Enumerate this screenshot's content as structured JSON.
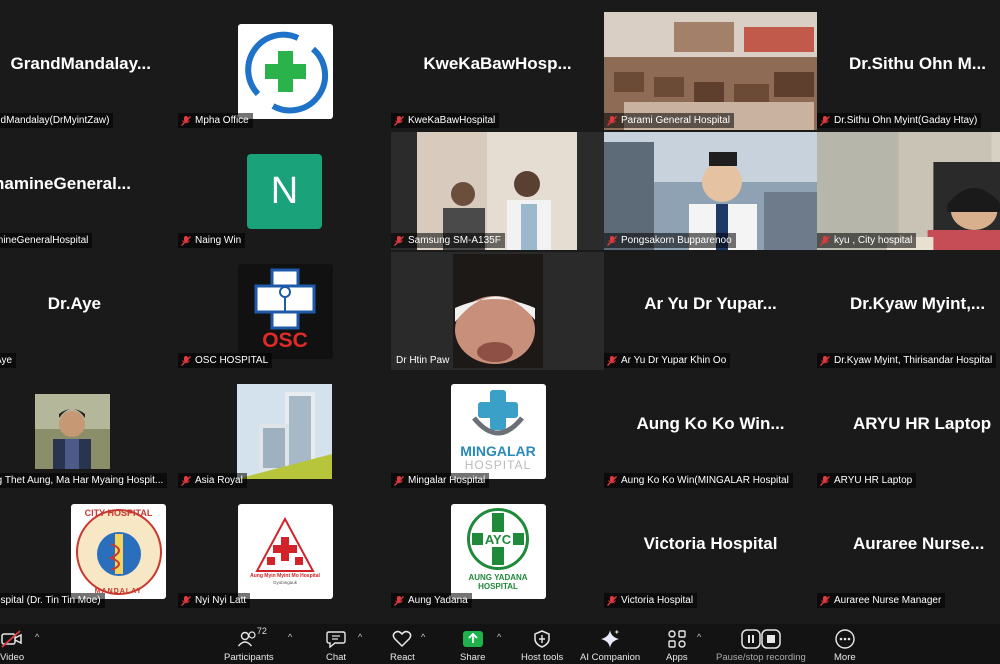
{
  "tiles": [
    {
      "name": "GrandMandalay...",
      "label": "ndMandalay(DrMyintZaw)"
    },
    {
      "name": "",
      "label": "Mpha Office"
    },
    {
      "name": "KweKaBawHosp...",
      "label": "KweKaBawHospital"
    },
    {
      "name": "",
      "label": "Parami General Hospital"
    },
    {
      "name": "Dr.Sithu Ohn M...",
      "label": "Dr.Sithu Ohn Myint(Gaday Htay)"
    },
    {
      "name": "ThamineGeneral...",
      "label": "mineGeneralHospital"
    },
    {
      "name": "",
      "label": "Naing Win",
      "avatar": "N"
    },
    {
      "name": "",
      "label": "Samsung SM-A135F"
    },
    {
      "name": "",
      "label": "Pongsakorn Bupparenoo"
    },
    {
      "name": "",
      "label": "kyu , City hospital"
    },
    {
      "name": "Dr.Aye",
      "label": "Aye"
    },
    {
      "name": "",
      "label": "OSC HOSPITAL",
      "logo_text": "OSC"
    },
    {
      "name": "",
      "label": "Dr Htin Paw"
    },
    {
      "name": "Ar Yu Dr Yupar...",
      "label": "Ar Yu Dr Yupar Khin Oo"
    },
    {
      "name": "Dr.Kyaw Myint,...",
      "label": "Dr.Kyaw Myint, Thirisandar Hospital"
    },
    {
      "name": "",
      "label": "aung Thet Aung, Ma Har Myaing Hospit..."
    },
    {
      "name": "",
      "label": "Asia Royal"
    },
    {
      "name": "",
      "label": "Mingalar Hospital",
      "logo_text": "MINGALAR",
      "logo_sub": "HOSPITAL"
    },
    {
      "name": "Aung Ko Ko Win...",
      "label": "Aung Ko Ko Win(MINGALAR Hospital"
    },
    {
      "name": "ARYU HR Laptop",
      "label": "ARYU HR Laptop"
    },
    {
      "name": "",
      "label": "y Hospital (Dr. Tin Tin Moe)",
      "logo_text": "CITY HOSPITAL",
      "logo_sub": "MANDALAY"
    },
    {
      "name": "",
      "label": "Nyi Nyi Latt",
      "logo_text": "Aung Myin Myint Mo Hospital",
      "logo_sub": "Gyobingauk"
    },
    {
      "name": "",
      "label": "Aung Yadana",
      "logo_text": "AYC",
      "logo_sub": "AUNG YADANA HOSPITAL"
    },
    {
      "name": "Victoria Hospital",
      "label": "Victoria Hospital"
    },
    {
      "name": "Auraree Nurse...",
      "label": "Auraree Nurse Manager"
    }
  ],
  "toolbar": {
    "video": "Video",
    "participants": "Participants",
    "participant_count": "72",
    "chat": "Chat",
    "react": "React",
    "share": "Share",
    "host_tools": "Host tools",
    "ai": "AI Companion",
    "apps": "Apps",
    "pause": "Pause/stop recording",
    "more": "More"
  },
  "colors": {
    "active_border": "#25b74b",
    "share_green": "#1fb14c",
    "muted_red": "#e0393e",
    "bg": "#1a1a1a"
  }
}
